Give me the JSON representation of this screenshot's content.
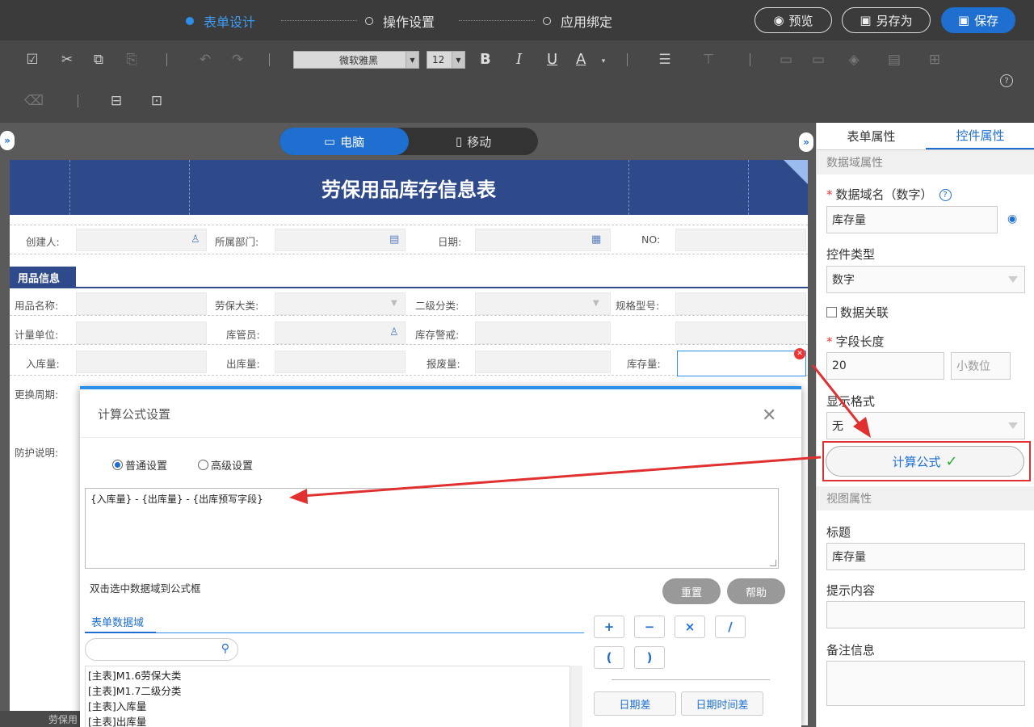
{
  "steps": [
    {
      "label": "表单设计",
      "active": true
    },
    {
      "label": "操作设置",
      "active": false
    },
    {
      "label": "应用绑定",
      "active": false
    }
  ],
  "top_buttons": {
    "preview": "预览",
    "save_as": "另存为",
    "save": "保存"
  },
  "toolbar": {
    "font_family": "微软雅黑",
    "font_size": "12",
    "bold": "B",
    "italic": "I",
    "underline": "U",
    "font_color": "A",
    "help": "?"
  },
  "device_toggle": {
    "desktop": "电脑",
    "mobile": "移动"
  },
  "form": {
    "title": "劳保用品库存信息表",
    "row1": [
      "创建人:",
      "所属部门:",
      "日期:",
      "NO:"
    ],
    "section": "用品信息",
    "row2": [
      "用品名称:",
      "劳保大类:",
      "二级分类:",
      "规格型号:"
    ],
    "row3": [
      "计量单位:",
      "库管员:",
      "库存警戒:"
    ],
    "row4": [
      "入库量:",
      "出库量:",
      "报废量:",
      "库存量:"
    ],
    "row5": [
      "更换周期:"
    ],
    "row6": [
      "防护说明:"
    ],
    "bottom_tab": "劳保用"
  },
  "modal": {
    "title": "计算公式设置",
    "radio_normal": "普通设置",
    "radio_advanced": "高级设置",
    "formula": "{入库量} - {出库量} - {出库预写字段}",
    "hint": "双击选中数据域到公式框",
    "reset": "重置",
    "help": "帮助",
    "tab": "表单数据域",
    "fields": [
      "[主表]M1.6劳保大类",
      "[主表]M1.7二级分类",
      "[主表]入库量",
      "[主表]出库量"
    ],
    "ops": [
      "+",
      "−",
      "×",
      "/",
      "(",
      ")"
    ],
    "fn_buttons": [
      "日期差",
      "日期时间差"
    ]
  },
  "panel": {
    "tabs": [
      "表单属性",
      "控件属性"
    ],
    "section_data": "数据域属性",
    "field_name_label": "数据域名（数字）",
    "field_name_value": "库存量",
    "control_type_label": "控件类型",
    "control_type_value": "数字",
    "data_link": "数据关联",
    "field_length_label": "字段长度",
    "field_length_value": "20",
    "decimal_placeholder": "小数位",
    "display_format_label": "显示格式",
    "display_format_value": "无",
    "calc_formula": "计算公式",
    "section_view": "视图属性",
    "title_label": "标题",
    "title_value": "库存量",
    "tip_label": "提示内容",
    "remark_label": "备注信息"
  },
  "colors": {
    "accent": "#1e6fd0",
    "header_blue": "#2f4a8a",
    "annotation_red": "#e03030"
  }
}
